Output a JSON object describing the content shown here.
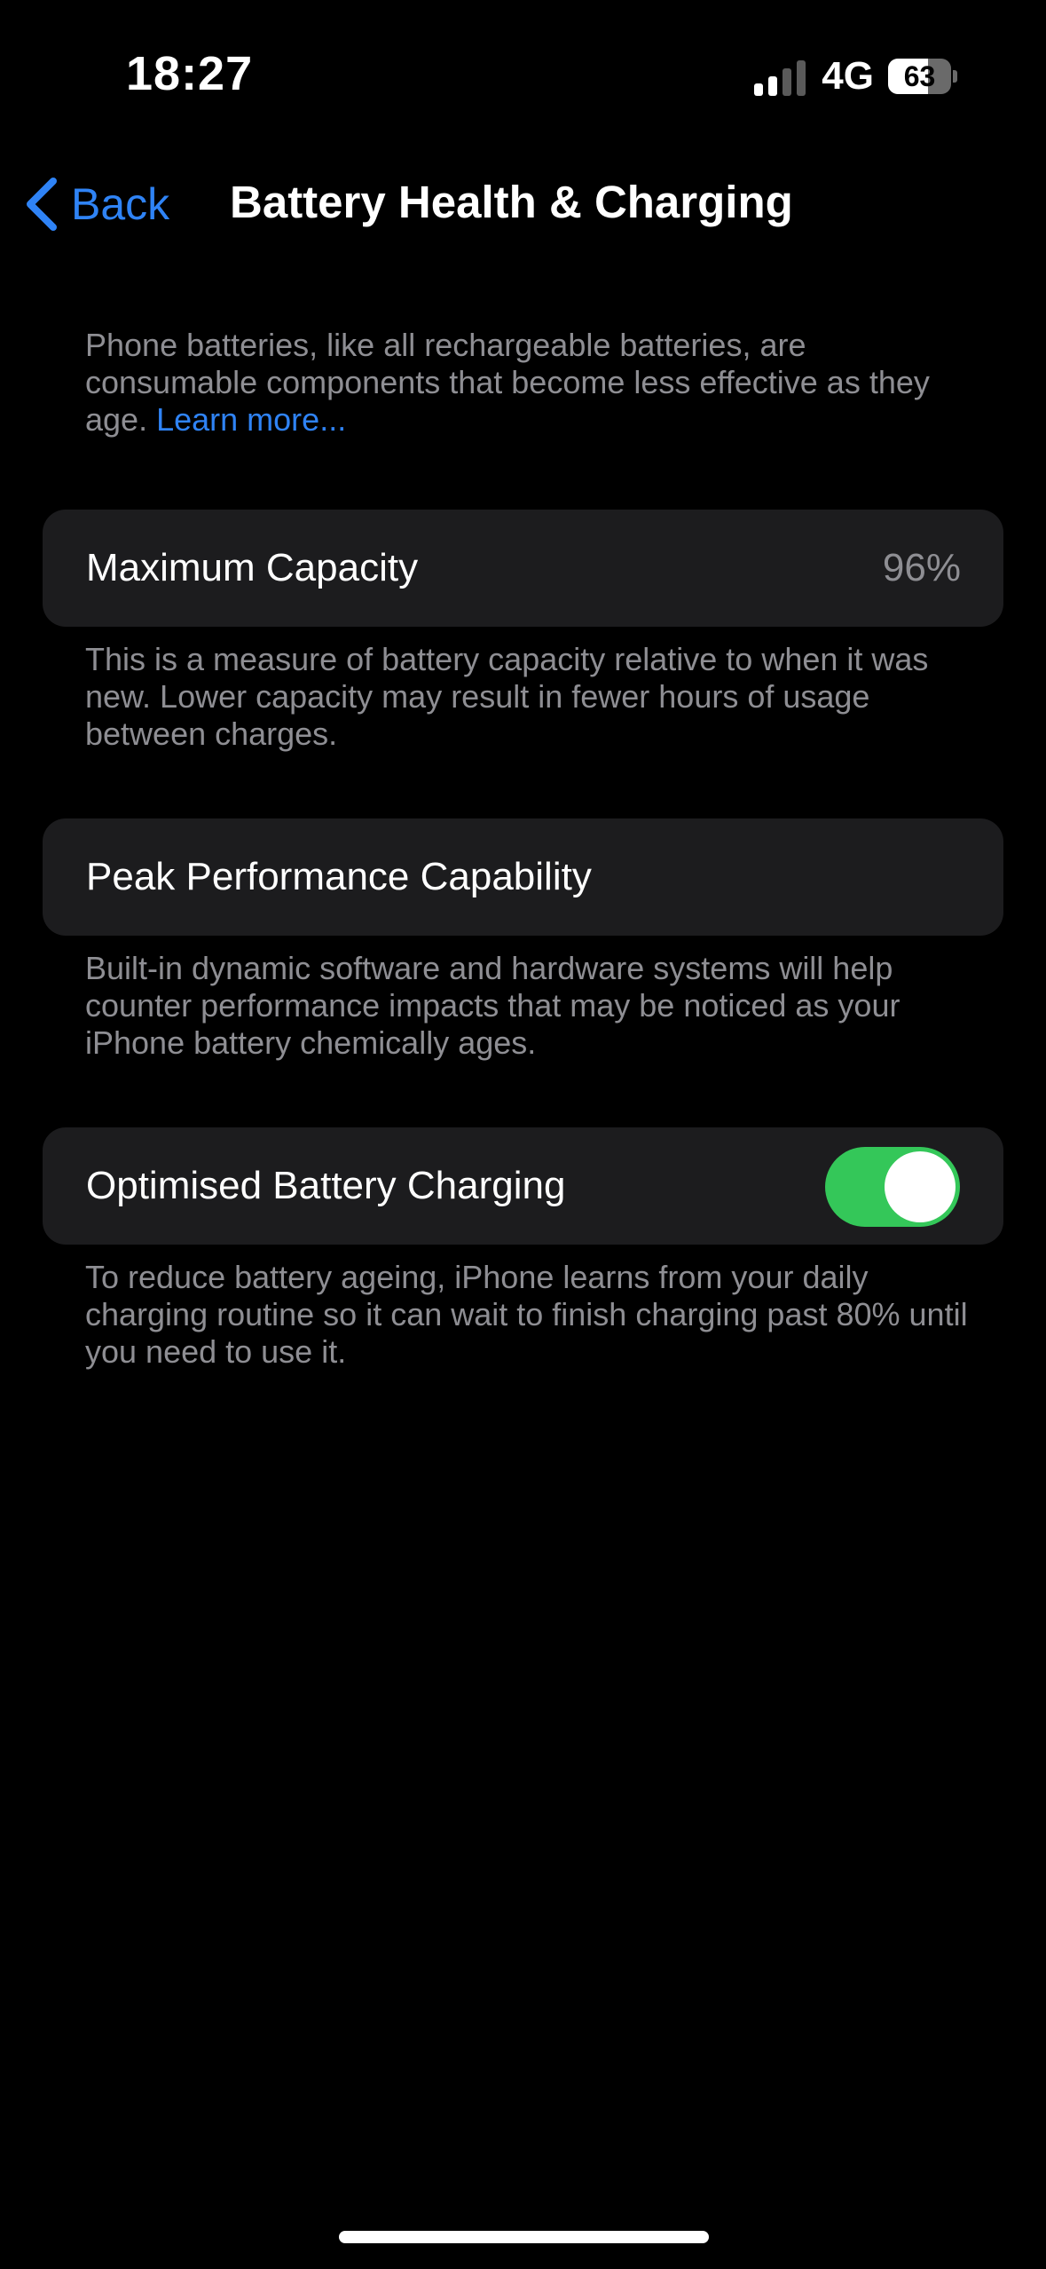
{
  "status_bar": {
    "time": "18:27",
    "network": "4G",
    "battery_level": "63",
    "battery_fraction": 0.63,
    "signal_bars_active": 2,
    "signal_bars_total": 4
  },
  "nav": {
    "back_label": "Back",
    "title": "Battery Health & Charging"
  },
  "intro": {
    "text": "Phone batteries, like all rechargeable batteries, are consumable components that become less effective as they age.",
    "link": "Learn more..."
  },
  "max_capacity": {
    "label": "Maximum Capacity",
    "value": "96%",
    "footer": "This is a measure of battery capacity relative to when it was new. Lower capacity may result in fewer hours of usage between charges."
  },
  "peak_performance": {
    "label": "Peak Performance Capability",
    "footer": "Built-in dynamic software and hardware systems will help counter performance impacts that may be noticed as your iPhone battery chemically ages."
  },
  "optimised_charging": {
    "label": "Optimised Battery Charging",
    "enabled": true,
    "footer": "To reduce battery ageing, iPhone learns from your daily charging routine so it can wait to finish charging past 80% until you need to use it."
  },
  "colors": {
    "background": "#000000",
    "card": "#1c1c1e",
    "accent": "#2f83f5",
    "toggle_on": "#34c759",
    "secondary_text": "#8e8e93"
  }
}
